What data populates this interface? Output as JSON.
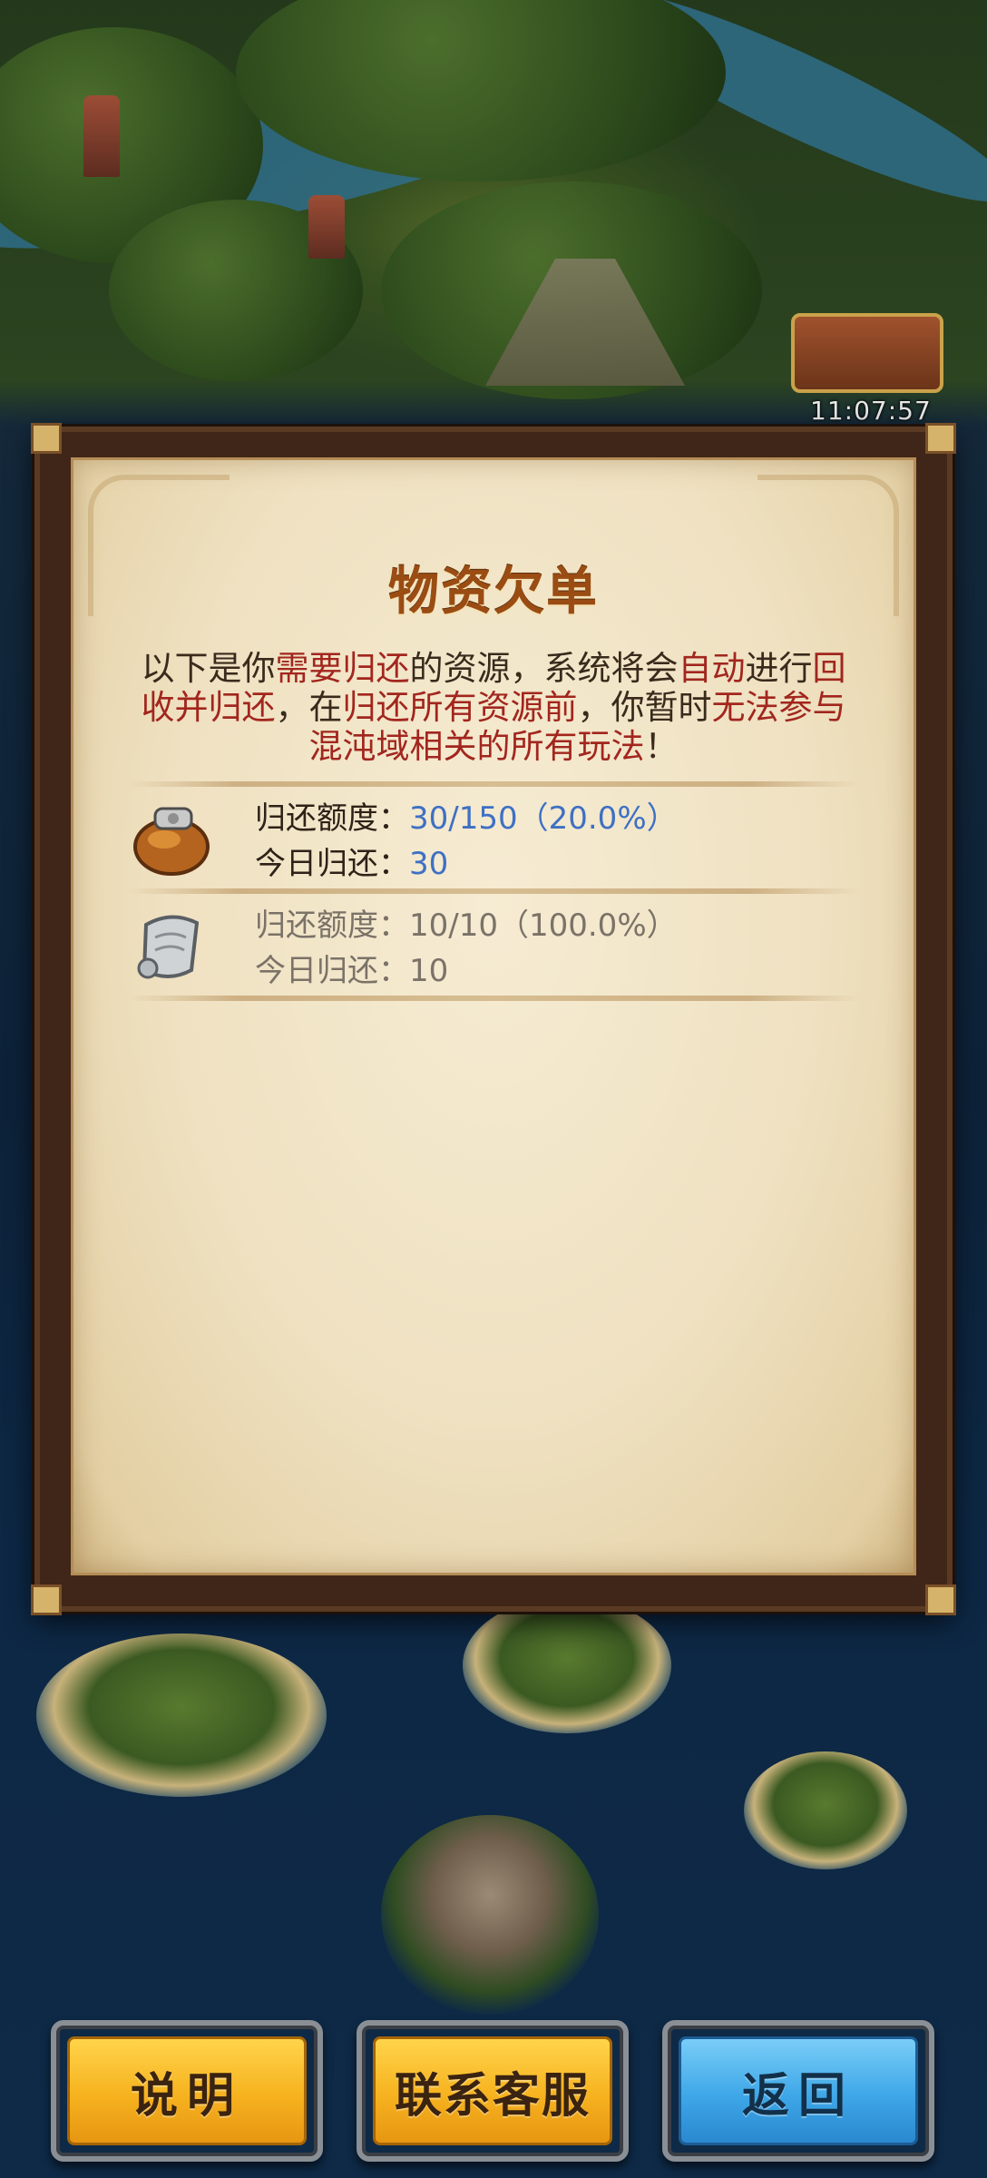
{
  "status": {
    "clock": "11:07:57"
  },
  "dialog": {
    "title": "物资欠单",
    "notice_parts": [
      {
        "text": "以下是你",
        "highlight": false
      },
      {
        "text": "需要归还",
        "highlight": true
      },
      {
        "text": "的资源，系统将会",
        "highlight": false
      },
      {
        "text": "自动",
        "highlight": true
      },
      {
        "text": "进行",
        "highlight": false
      },
      {
        "text": "回收并归还",
        "highlight": true
      },
      {
        "text": "，在",
        "highlight": false
      },
      {
        "text": "归还所有资源前",
        "highlight": true
      },
      {
        "text": "，你暂时",
        "highlight": false
      },
      {
        "text": "无法参与混沌域相关的所有玩法",
        "highlight": true
      },
      {
        "text": "！",
        "highlight": false
      }
    ],
    "resources": [
      {
        "icon": "bag-icon",
        "quota_label": "归还额度：",
        "quota_value": "30/150（20.0%）",
        "today_label": "今日归还：",
        "today_value": "30",
        "completed": false
      },
      {
        "icon": "scroll-icon",
        "quota_label": "归还额度：",
        "quota_value": "10/10（100.0%）",
        "today_label": "今日归还：",
        "today_value": "10",
        "completed": true
      }
    ]
  },
  "buttons": {
    "help": "说明",
    "contact": "联系客服",
    "back": "返回"
  },
  "colors": {
    "title": "#9a4c13",
    "highlight": "#a2261e",
    "value_blue": "#3e70c4",
    "completed_grey": "#7b7268",
    "button_gold": "#f6b21f",
    "button_blue": "#3ea7e8"
  }
}
